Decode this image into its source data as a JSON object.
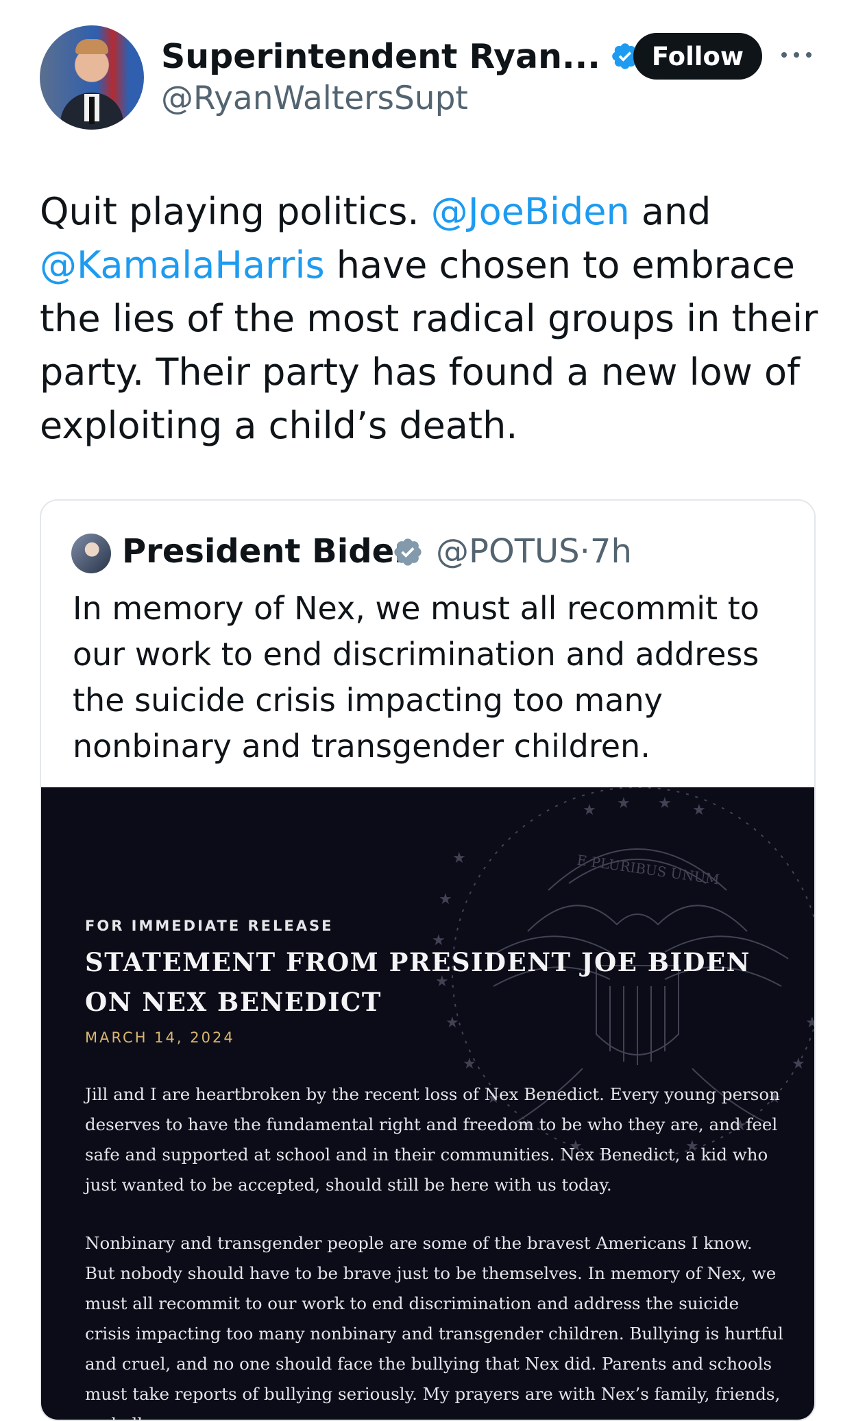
{
  "tweet": {
    "author": {
      "display_name": "Superintendent Ryan...",
      "handle": "@RyanWaltersSupt"
    },
    "follow_label": "Follow",
    "text": {
      "part1": "Quit playing politics. ",
      "mention1": "@JoeBiden",
      "part2": " and ",
      "mention2": "@KamalaHarris",
      "part3": " have chosen to embrace the lies of the most radical groups in their party. Their party has found a new low of exploiting a child’s death."
    }
  },
  "quoted_tweet": {
    "display_name": "President Biden",
    "handle": "@POTUS",
    "separator": "·",
    "time": "7h",
    "text": "In memory of Nex, we must all recommit to our work to end discrimination and address the suicide crisis impacting too many nonbinary and transgender children.",
    "image": {
      "release_label": "FOR IMMEDIATE RELEASE",
      "headline": "STATEMENT FROM PRESIDENT JOE BIDEN ON NEX BENEDICT",
      "date": "MARCH 14, 2024",
      "seal_motto": "E PLURIBUS UNUM",
      "paragraph1": "Jill and I are heartbroken by the recent loss of Nex Benedict. Every young person deserves to have the fundamental right and freedom to be who they are, and feel safe and supported at school and in their communities. Nex Benedict, a kid who just wanted to be accepted, should still be here with us today.",
      "paragraph2": "Nonbinary and transgender people are some of the bravest Americans I know. But nobody should have to be brave just to be themselves. In memory of Nex, we must all recommit to our work to end discrimination and address the suicide crisis impacting too many nonbinary and transgender children. Bullying is hurtful and cruel, and no one should face the bullying that Nex did. Parents and schools must take reports of bullying seriously. My prayers are with Nex’s family, friends, and all"
    }
  },
  "colors": {
    "link": "#1d9bf0",
    "verified": "#1d9bf0",
    "verified_gov": "#829aab",
    "statement_bg": "#0c0c18",
    "date_gold": "#d8b770"
  },
  "icons": {
    "verified_badge": "verified-badge-icon",
    "more": "more-options-icon"
  }
}
